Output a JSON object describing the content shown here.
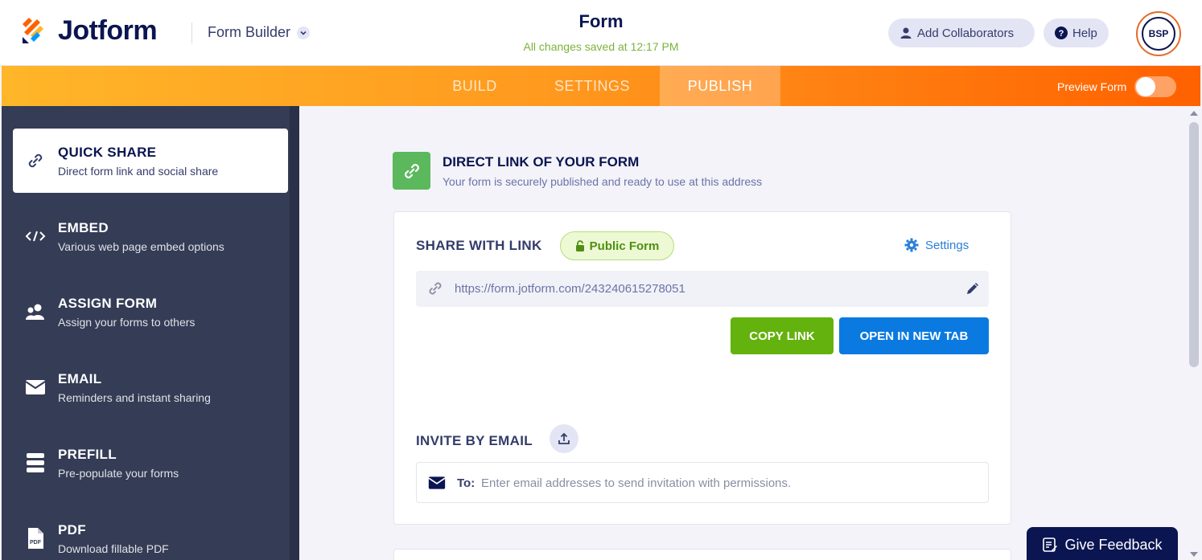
{
  "header": {
    "brand": "Jotform",
    "builder_label": "Form Builder",
    "form_title": "Form",
    "saved_status": "All changes saved at 12:17 PM",
    "collab_label": "Add Collaborators",
    "help_label": "Help",
    "avatar_initials": "BSP"
  },
  "nav": {
    "tabs": [
      {
        "label": "BUILD"
      },
      {
        "label": "SETTINGS"
      },
      {
        "label": "PUBLISH",
        "active": true
      }
    ],
    "preview_label": "Preview Form",
    "preview_on": false
  },
  "sidebar": {
    "items": [
      {
        "title": "QUICK SHARE",
        "subtitle": "Direct form link and social share",
        "icon": "link-icon",
        "active": true
      },
      {
        "title": "EMBED",
        "subtitle": "Various web page embed options",
        "icon": "code-icon"
      },
      {
        "title": "ASSIGN FORM",
        "subtitle": "Assign your forms to others",
        "icon": "users-icon"
      },
      {
        "title": "EMAIL",
        "subtitle": "Reminders and instant sharing",
        "icon": "envelope-icon"
      },
      {
        "title": "PREFILL",
        "subtitle": "Pre-populate your forms",
        "icon": "database-icon"
      },
      {
        "title": "PDF",
        "subtitle": "Download fillable PDF",
        "icon": "pdf-icon"
      }
    ]
  },
  "main": {
    "section_title": "DIRECT LINK OF YOUR FORM",
    "section_subtitle": "Your form is securely published and ready to use at this address",
    "share_label": "SHARE WITH LINK",
    "public_badge": "Public Form",
    "settings_label": "Settings",
    "url": "https://form.jotform.com/243240615278051",
    "copy_label": "COPY LINK",
    "open_label": "OPEN IN NEW TAB",
    "invite_label": "INVITE BY EMAIL",
    "email_to_label": "To:",
    "email_placeholder": "Enter email addresses to send invitation with permissions.",
    "feedback_label": "Give Feedback"
  },
  "colors": {
    "brand_navy": "#0a1551",
    "nav_orange": "#ff6100",
    "sidebar_bg": "#343c56",
    "copy_green": "#64b20e",
    "open_blue": "#0a7ae0",
    "link_blue": "#2b7fd6"
  }
}
